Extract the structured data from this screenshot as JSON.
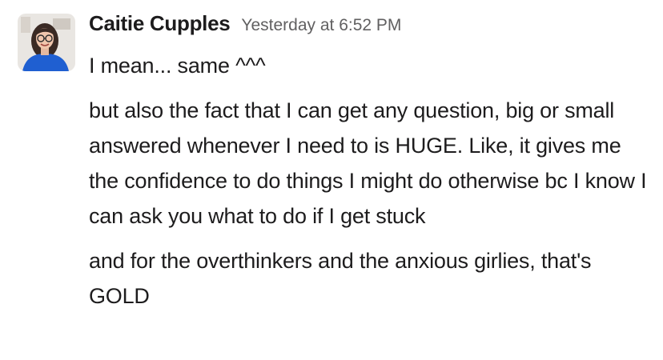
{
  "message": {
    "author": "Caitie Cupples",
    "timestamp": "Yesterday at 6:52 PM",
    "avatar_icon": "user-avatar-photo",
    "paragraphs": [
      "I mean... same ^^^",
      "but also the fact that I can get any question, big or small answered whenever I need to is HUGE. Like, it gives me the confidence to do things I might do otherwise bc I know I can ask you what to do if I get stuck",
      "and for the overthinkers and the anxious girlies, that's GOLD"
    ]
  },
  "colors": {
    "text": "#1d1c1d",
    "timestamp": "#616061",
    "background": "#ffffff",
    "avatar_shirt": "#1f5fd1"
  }
}
